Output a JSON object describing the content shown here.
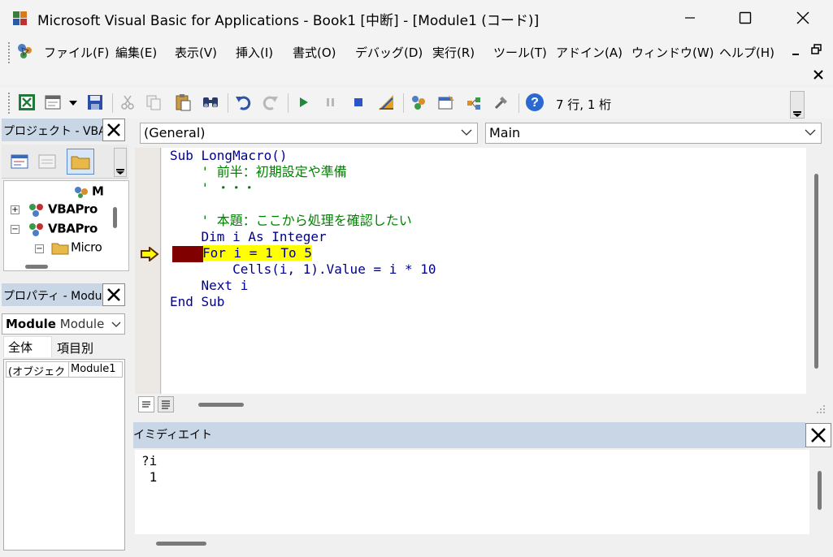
{
  "window": {
    "title": "Microsoft Visual Basic for Applications - Book1 [中断] - [Module1 (コード)]"
  },
  "menu": {
    "items": [
      "ファイル(F)",
      "編集(E)",
      "表示(V)",
      "挿入(I)",
      "書式(O)",
      "デバッグ(D)",
      "実行(R)",
      "ツール(T)",
      "アドイン(A)",
      "ウィンドウ(W)",
      "ヘルプ(H)"
    ]
  },
  "toolbar": {
    "status": "7 行, 1 桁"
  },
  "project": {
    "title": "プロジェクト - VBAP",
    "tree": [
      "M",
      "VBAPro",
      "VBAPro",
      "Micro"
    ]
  },
  "properties": {
    "title": "プロパティ - Module",
    "object_name": "Module",
    "object_type": "Module",
    "tabs": [
      "全体",
      "項目別"
    ],
    "rows": [
      {
        "name": "(オブジェクト名)",
        "value": "Module1"
      }
    ]
  },
  "code": {
    "object_combo": "(General)",
    "proc_combo": "Main",
    "lines": [
      {
        "kind": "kw",
        "text": "Sub LongMacro()"
      },
      {
        "kind": "cmt",
        "text": "    ' 前半：初期設定や準備"
      },
      {
        "kind": "cmt",
        "text": "    ' ・・・"
      },
      {
        "kind": "plain",
        "text": ""
      },
      {
        "kind": "cmt",
        "text": "    ' 本題：ここから処理を確認したい"
      },
      {
        "kind": "kw",
        "text": "    Dim i As Integer"
      },
      {
        "kind": "hl",
        "text": "For i = 1 To 5"
      },
      {
        "kind": "kw",
        "text": "        Cells(i, 1).Value = i * 10"
      },
      {
        "kind": "kw",
        "text": "    Next i"
      },
      {
        "kind": "kw",
        "text": "End Sub"
      }
    ]
  },
  "immediate": {
    "title": "イミディエイト",
    "lines": [
      "?i",
      " 1"
    ]
  },
  "colors": {
    "keyword": "#00008b",
    "comment": "#008000",
    "highlight": "#ffff00",
    "breakpoint": "#800000",
    "pane_header": "#c8d6e6"
  },
  "icons": [
    "vba-app-icon",
    "minimize-icon",
    "maximize-icon",
    "close-icon",
    "excel-view-icon",
    "insert-module-icon",
    "save-icon",
    "cut-icon",
    "copy-icon",
    "paste-icon",
    "find-icon",
    "undo-icon",
    "redo-icon",
    "run-icon",
    "break-icon",
    "reset-icon",
    "design-mode-icon",
    "project-explorer-icon",
    "properties-icon",
    "object-browser-icon",
    "toolbox-icon",
    "help-icon",
    "execution-arrow-icon"
  ]
}
